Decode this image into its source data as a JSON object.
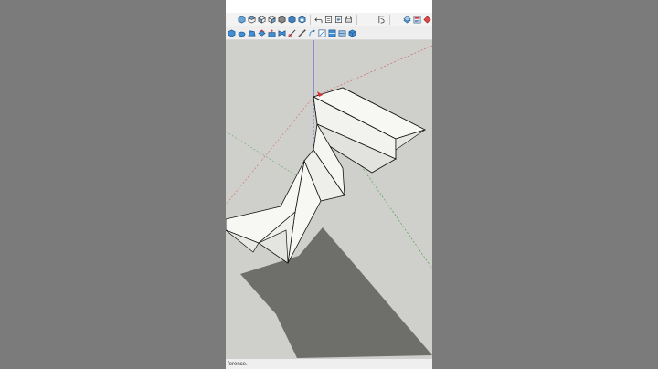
{
  "toolbar_top": {
    "icons": [
      "iso-view-icon",
      "top-view-icon",
      "front-view-icon",
      "right-view-icon",
      "back-view-icon",
      "left-view-icon",
      "xray-icon",
      "undo-icon",
      "paste-icon",
      "text-icon",
      "print-icon",
      "layers-icon",
      "layers-alt-icon",
      "model-info-icon",
      "unknown-red-icon"
    ]
  },
  "toolbar_second": {
    "icons": [
      "box-icon",
      "cylinder-icon",
      "shape-icon",
      "layers-icon",
      "pushpull-icon",
      "flip-icon",
      "cut-icon",
      "tape-icon",
      "rotate-icon",
      "move-icon",
      "scale-icon",
      "section-icon",
      "component-icon"
    ]
  },
  "status": {
    "text": "ference."
  },
  "colors": {
    "sky": "#cfd0cc",
    "ground_shadow": "#6e6e6a",
    "face": "#f7f8f4",
    "face_shade": "#e2e3df",
    "axis_blue": "#2c2cd6",
    "axis_green": "#3ba03b",
    "axis_red": "#d83030"
  }
}
